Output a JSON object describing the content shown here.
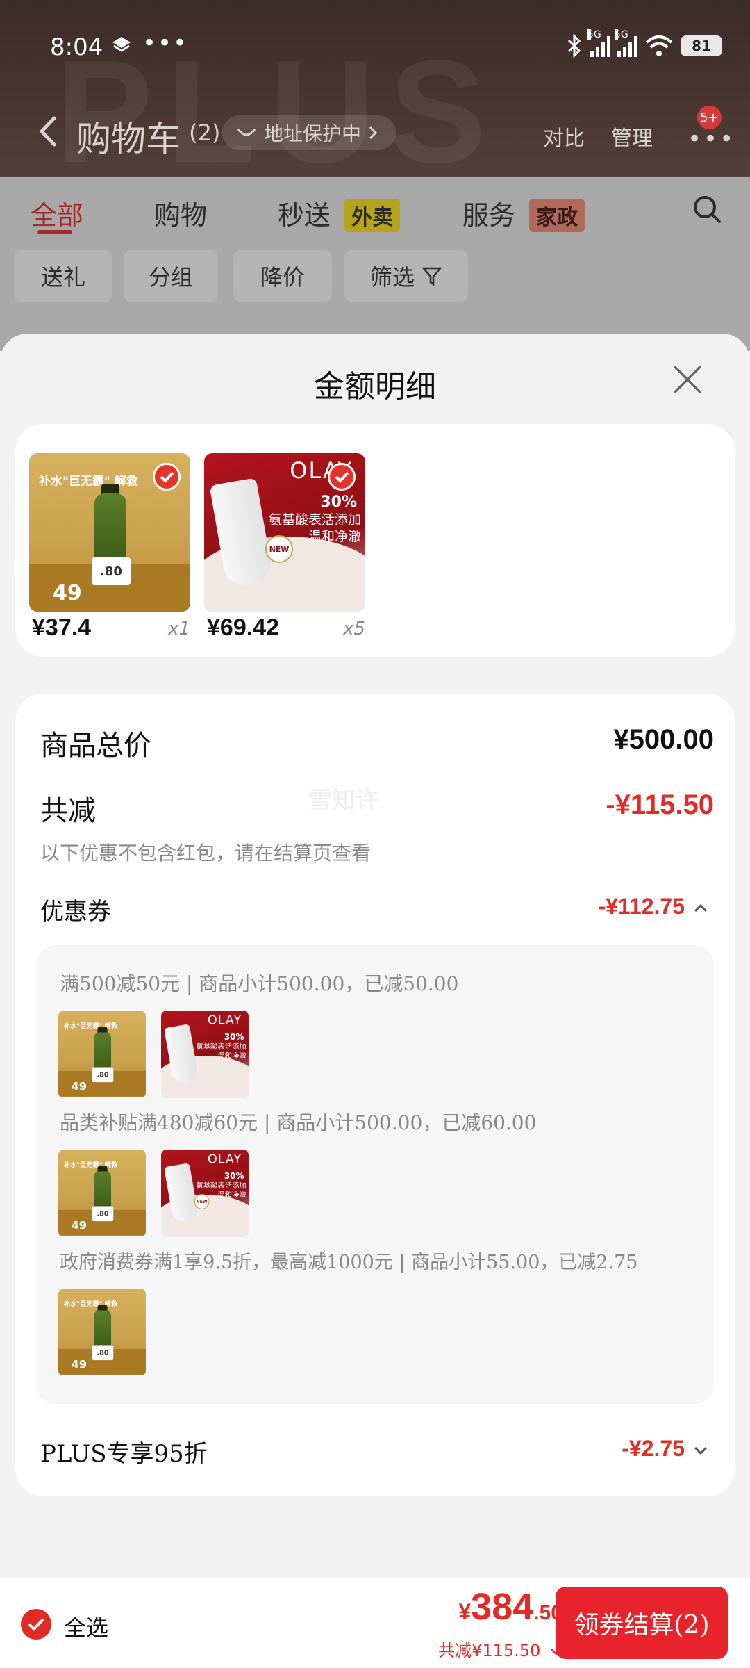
{
  "status_bar": {
    "time": "8:04",
    "dots": "•••",
    "network_tag": "5G",
    "battery": "81"
  },
  "header": {
    "watermark": "PLUS",
    "title": "购物车",
    "count": "(2)",
    "address_pill": "地址保护中",
    "compare": "对比",
    "manage": "管理",
    "more_badge": "5+"
  },
  "tabs": [
    {
      "label": "全部",
      "badge": ""
    },
    {
      "label": "购物",
      "badge": ""
    },
    {
      "label": "秒送",
      "badge": "外卖"
    },
    {
      "label": "服务",
      "badge": "家政"
    }
  ],
  "filters": [
    "送礼",
    "分组",
    "降价",
    "筛选"
  ],
  "sheet": {
    "title": "金额明细",
    "products": [
      {
        "price": "¥37.4",
        "qty": "x1",
        "art": "gold",
        "art_title": "补水\"巨无霸\" 解救",
        "art_price": "49",
        "art_tag": ".80"
      },
      {
        "price": "¥69.42",
        "qty": "x5",
        "art": "red",
        "art_logo": "OLAY",
        "art_pct": "30%",
        "art_text": "氨基酸表活添加\n温和净澈",
        "art_new": "NEW"
      }
    ],
    "summary": {
      "total_label": "商品总价",
      "total_value": "¥500.00",
      "discount_label": "共减",
      "discount_value": "-¥115.50",
      "note": "以下优惠不包含红包，请在结算页查看",
      "watermark": "雪知许",
      "coupon_label": "优惠券",
      "coupon_value": "-¥112.75",
      "coupon_lines": [
        "满500减50元 | 商品小计500.00，已减50.00",
        "品类补贴满480减60元 | 商品小计500.00，已减60.00",
        "政府消费券满1享9.5折，最高减1000元 | 商品小计55.00，已减2.75"
      ],
      "plus_label": "PLUS专享95折",
      "plus_value": "-¥2.75"
    }
  },
  "bottom_bar": {
    "select_all": "全选",
    "currency": "¥",
    "total_int": "384",
    "total_dec": ".50",
    "saved": "共减¥115.50",
    "checkout": "领券结算(2)"
  },
  "colors": {
    "accent_red": "#e22b24",
    "header_brown": "#4a3630",
    "dim_gray": "#a8a8a8"
  }
}
